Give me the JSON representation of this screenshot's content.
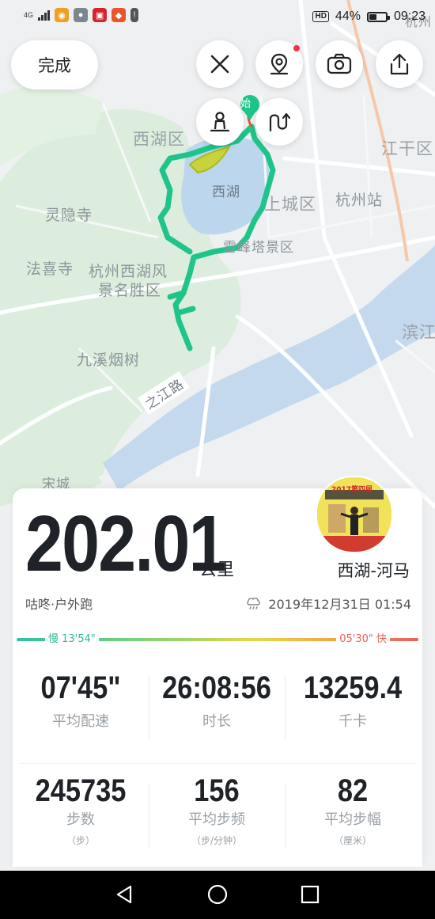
{
  "status_bar": {
    "network": "4G",
    "hd": "HD",
    "battery": "44%",
    "battery_level": 0.44,
    "time": "09:23"
  },
  "map": {
    "labels": {
      "xihu_district": "西湖区",
      "west_lake": "西湖",
      "shangcheng": "上城区",
      "hangzhou_station": "杭州站",
      "lingyin": "灵隐寺",
      "faxi": "法喜寺",
      "scenic_1": "杭州西湖风",
      "scenic_2": "景名胜区",
      "leifeng": "雷峰塔景区",
      "jiuxi": "九溪烟树",
      "zhijiang_road": "之江路",
      "songcheng": "宋城",
      "jianggan": "江干区",
      "binjiang": "滨江",
      "hangzhou_top": "杭州",
      "start_marker": "始"
    }
  },
  "toolbar": {
    "done_label": "完成",
    "icons": [
      "close-icon",
      "location-pin-icon",
      "camera-icon",
      "share-icon",
      "person-icon",
      "route-toggle-icon"
    ]
  },
  "summary": {
    "distance": "202.01",
    "unit": "公里",
    "route_name": "西湖-河马",
    "source": "咕咚·户外跑",
    "datetime": "2019年12月31日 01:54",
    "pace_slow": "慢 13'54\"",
    "pace_fast": "05'30\" 快",
    "avatar_caption": "2017第四届"
  },
  "stats": [
    {
      "value": "07'45\"",
      "label": "平均配速",
      "sub": ""
    },
    {
      "value": "26:08:56",
      "label": "时长",
      "sub": ""
    },
    {
      "value": "13259.4",
      "label": "千卡",
      "sub": ""
    },
    {
      "value": "245735",
      "label": "步数",
      "sub": "（步）"
    },
    {
      "value": "156",
      "label": "平均步频",
      "sub": "（步/分钟）"
    },
    {
      "value": "82",
      "label": "平均步幅",
      "sub": "（厘米）"
    }
  ],
  "colors": {
    "route": "#1fc48a",
    "accent_slow": "#2bb69a",
    "accent_fast": "#e8615a"
  }
}
